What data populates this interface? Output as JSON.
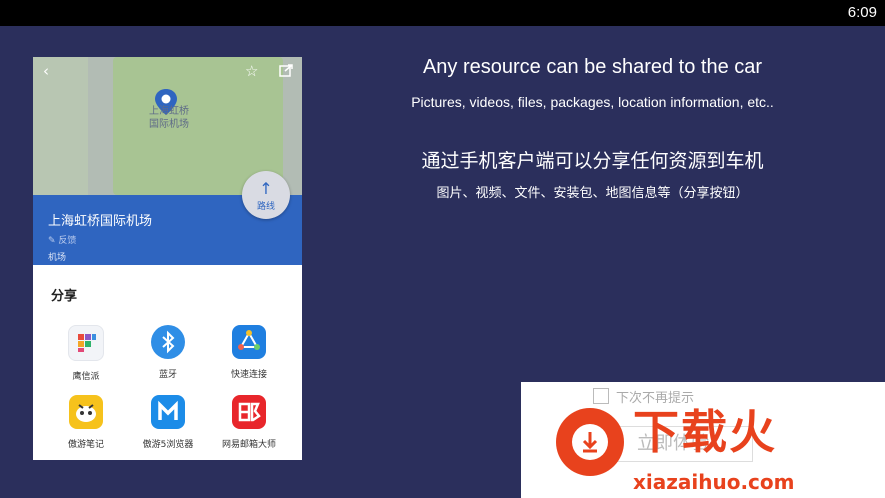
{
  "status_bar": {
    "time": "6:09"
  },
  "phone": {
    "map_label": "上海虹桥\n国际机场",
    "icons": {
      "back": "chevron-left-icon",
      "favorite": "star-icon",
      "share": "share-icon"
    },
    "route_button": {
      "label": "路线"
    },
    "poi": {
      "name": "上海虹桥国际机场",
      "feedback": "反馈",
      "category": "机场"
    },
    "share_sheet": {
      "title": "分享",
      "apps": [
        {
          "label": "鹰信派"
        },
        {
          "label": "蓝牙"
        },
        {
          "label": "快速连接"
        },
        {
          "label": "傲游笔记"
        },
        {
          "label": "傲游5浏览器"
        },
        {
          "label": "网易邮箱大师"
        }
      ]
    }
  },
  "promo": {
    "headline_en": "Any resource  can be shared to the car",
    "sub_en": "Pictures, videos, files, packages, location information, etc..",
    "headline_zh": "通过手机客户端可以分享任何资源到车机",
    "sub_zh": "图片、视频、文件、安装包、地图信息等（分享按钮）"
  },
  "watermark": {
    "hint": "下次不再提示",
    "button": "立即体验",
    "brand": "下载火",
    "url": "xiazaihuo.com"
  },
  "colors": {
    "background": "#2b2f5c",
    "poi_blue": "#2f65c0",
    "brand_red": "#e8421d"
  }
}
